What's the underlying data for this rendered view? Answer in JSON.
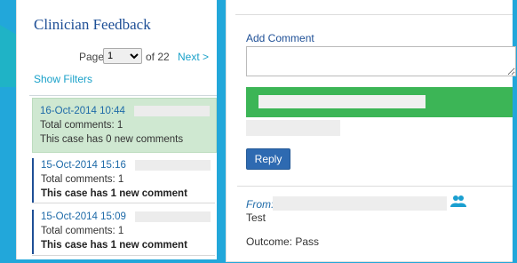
{
  "header": {
    "title": "Clinician Feedback"
  },
  "pager": {
    "page_label": "Page",
    "current_page": "1",
    "of_label": "of 22",
    "next_label": "Next >"
  },
  "filters": {
    "show_filters_label": "Show Filters"
  },
  "cases": [
    {
      "date": "16-Oct-2014 10:44",
      "total": "Total comments: 1",
      "status": "This case has 0 new comments",
      "selected": true
    },
    {
      "date": "15-Oct-2014 15:16",
      "total": "Total comments: 1",
      "status": "This case has 1 new comment",
      "selected": false
    },
    {
      "date": "15-Oct-2014 15:09",
      "total": "Total comments: 1",
      "status": "This case has 1 new comment",
      "selected": false
    }
  ],
  "detail": {
    "add_comment_label": "Add Comment",
    "reply_label": "Reply",
    "from_label": "From:",
    "message_text": "Test",
    "outcome_text": "Outcome: Pass"
  },
  "icons": {
    "sender": "people-icon"
  },
  "colors": {
    "frame": "#22a7da",
    "accent": "#1fb3c6",
    "banner": "#3cb556",
    "button": "#2e6ab1",
    "selected_case": "#cfe8d1"
  }
}
